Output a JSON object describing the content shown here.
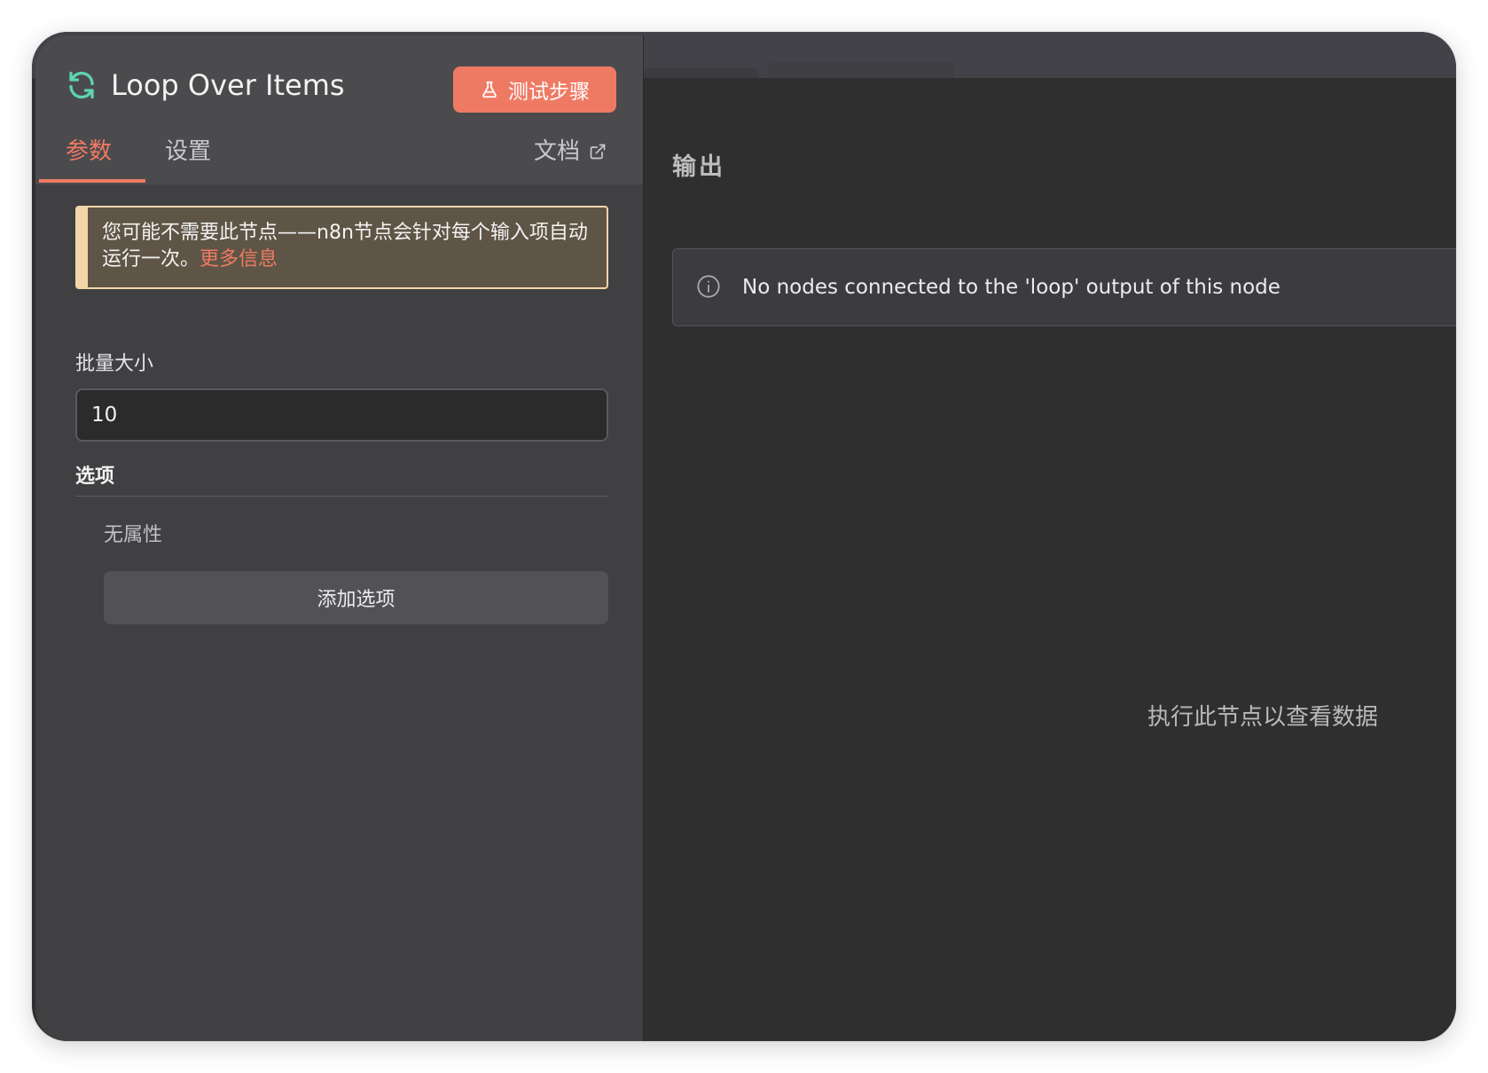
{
  "node": {
    "title": "Loop Over Items",
    "icon": "refresh-icon",
    "accent_color": "#5fd3b0"
  },
  "header": {
    "test_button_label": "测试步骤",
    "test_button_icon": "flask-icon",
    "brand_color": "#ef7a63"
  },
  "tabs": [
    {
      "label": "参数",
      "active": true
    },
    {
      "label": "设置",
      "active": false
    }
  ],
  "docs": {
    "label": "文档",
    "icon": "external-link-icon"
  },
  "notice": {
    "text": "您可能不需要此节点——n8n节点会针对每个输入项自动运行一次。",
    "link_label": "更多信息"
  },
  "params": {
    "batch_size_label": "批量大小",
    "batch_size_value": "10",
    "options_title": "选项",
    "no_properties": "无属性",
    "add_option_label": "添加选项"
  },
  "output": {
    "title": "输出",
    "info_message": "No nodes connected to the 'loop' output of this node",
    "info_icon": "info-icon",
    "empty_hint": "执行此节点以查看数据"
  }
}
